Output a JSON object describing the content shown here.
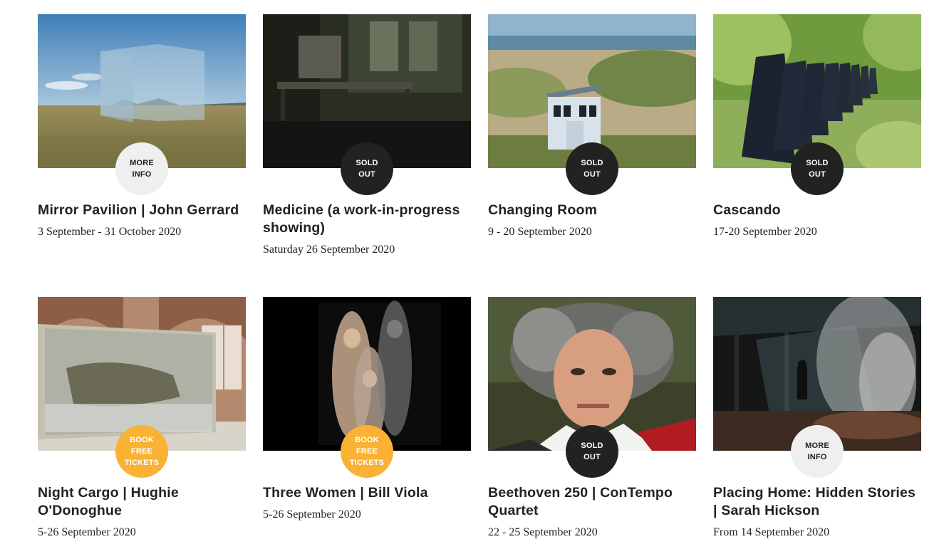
{
  "events": [
    {
      "title": "Mirror Pavilion | John Gerrard",
      "date": "3 September - 31 October 2020",
      "badge": "MORE\nINFO",
      "badge_type": "more",
      "image": "mirror-cube-on-moorland"
    },
    {
      "title": "Medicine (a work-in-progress showing)",
      "date": "Saturday 26 September 2020",
      "badge": "SOLD\nOUT",
      "badge_type": "sold",
      "image": "abandoned-hospital-room"
    },
    {
      "title": "Changing Room",
      "date": "9 - 20 September 2020",
      "badge": "SOLD\nOUT",
      "badge_type": "sold",
      "image": "white-hut-in-dunes"
    },
    {
      "title": "Cascando",
      "date": "17-20 September 2020",
      "badge": "SOLD\nOUT",
      "badge_type": "sold",
      "image": "hooded-figures-walking"
    },
    {
      "title": "Night Cargo | Hughie O'Donoghue",
      "date": "5-26 September 2020",
      "badge": "BOOK\nFREE\nTICKETS",
      "badge_type": "book",
      "image": "ship-painting-in-church"
    },
    {
      "title": "Three Women | Bill Viola",
      "date": "5-26 September 2020",
      "badge": "BOOK\nFREE\nTICKETS",
      "badge_type": "book",
      "image": "three-women-video"
    },
    {
      "title": "Beethoven 250 | ConTempo Quartet",
      "date": "22 - 25 September 2020",
      "badge": "SOLD\nOUT",
      "badge_type": "sold",
      "image": "beethoven-portrait"
    },
    {
      "title": "Placing Home: Hidden Stories | Sarah Hickson",
      "date": "From 14 September 2020",
      "badge": "MORE\nINFO",
      "badge_type": "more",
      "image": "smoky-derelict-building"
    }
  ],
  "colors": {
    "badge_more": "#efefef",
    "badge_sold": "#222222",
    "badge_book": "#f9b233",
    "text": "#222222"
  }
}
